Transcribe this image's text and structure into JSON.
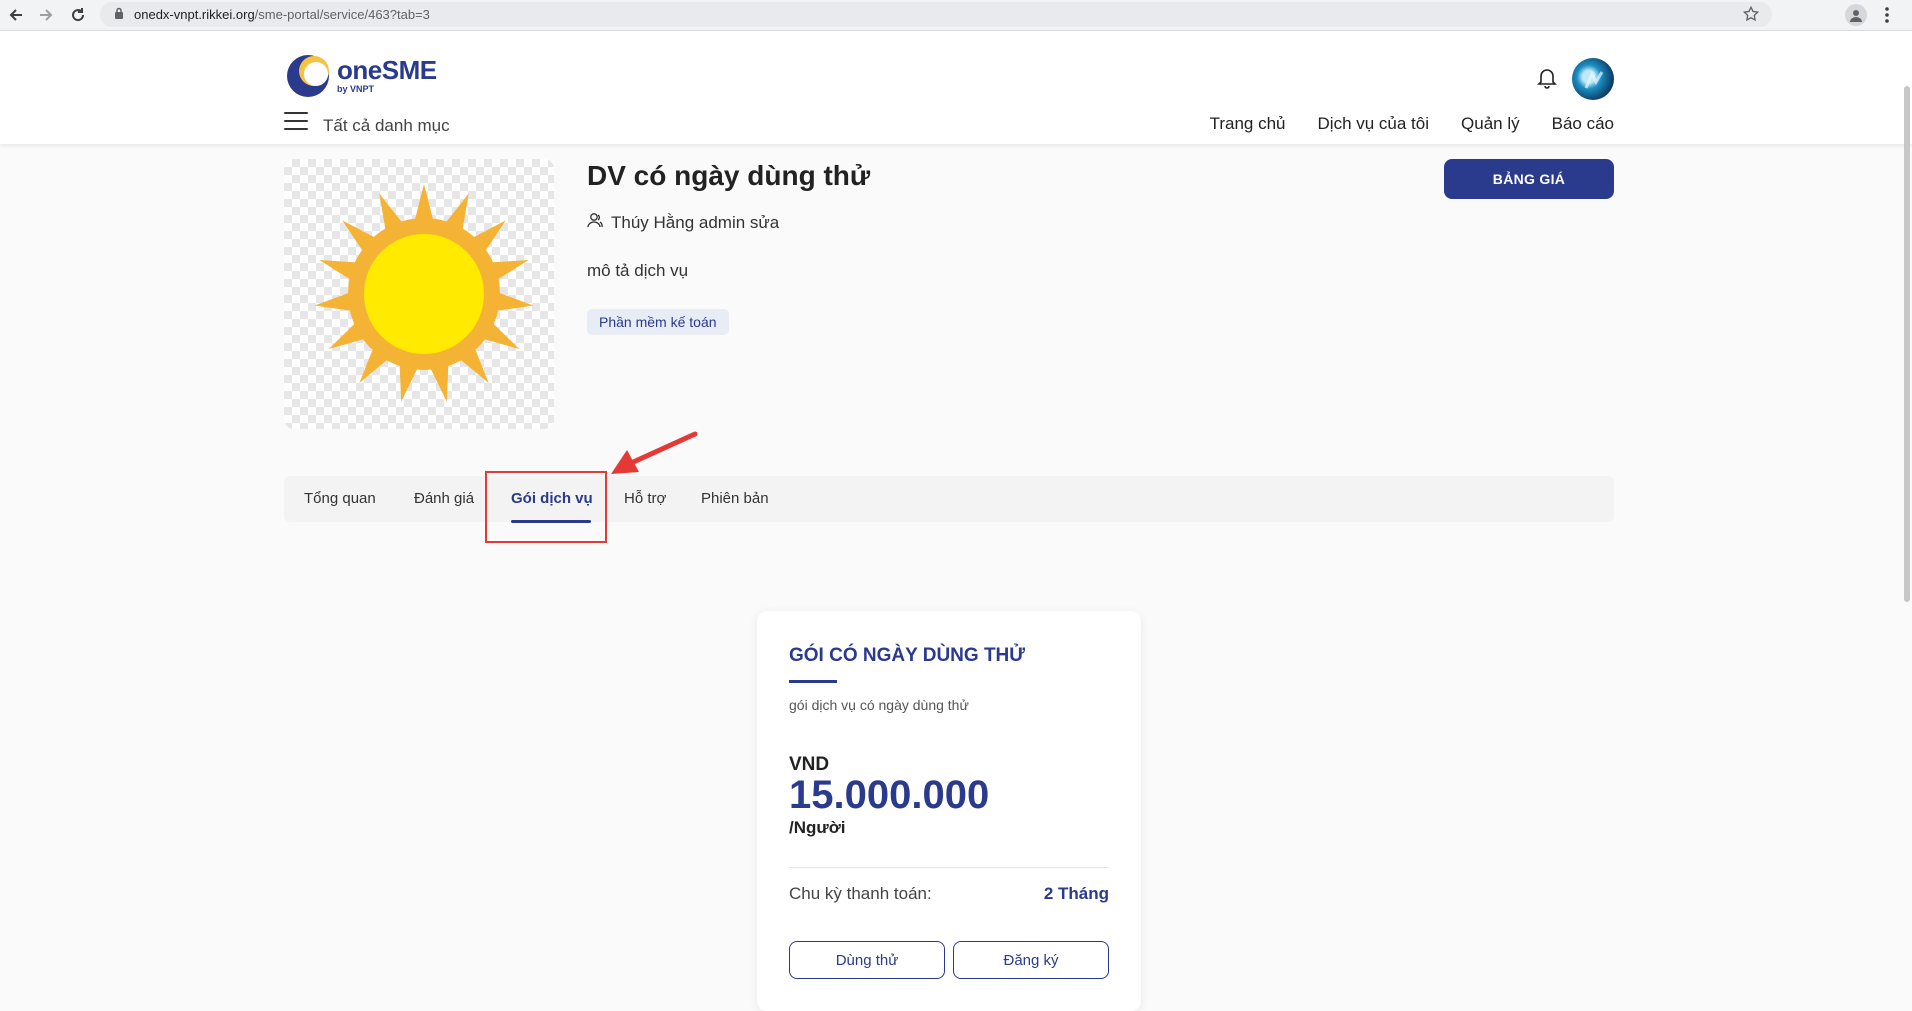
{
  "browser": {
    "url_host": "onedx-vnpt.rikkei.org",
    "url_path": "/sme-portal/service/463?tab=3"
  },
  "header": {
    "logo_text": "oneSME",
    "logo_sub": "by VNPT",
    "all_categories": "Tất cả danh mục",
    "nav": [
      "Trang chủ",
      "Dịch vụ của tôi",
      "Quản lý",
      "Báo cáo"
    ]
  },
  "service": {
    "title": "DV có ngày dùng thử",
    "owner": "Thúy Hằng admin sửa",
    "description": "mô tả dịch vụ",
    "tag": "Phần mềm kế toán",
    "price_button": "BẢNG GIÁ"
  },
  "tabs": [
    "Tổng quan",
    "Đánh giá",
    "Gói dịch vụ",
    "Hỗ trợ",
    "Phiên bản"
  ],
  "active_tab": "Gói dịch vụ",
  "package": {
    "title": "GÓI CÓ NGÀY DÙNG THỬ",
    "description": "gói dịch vụ có ngày dùng thử",
    "currency": "VND",
    "amount": "15.000.000",
    "unit": "/Người",
    "cycle_label": "Chu kỳ thanh toán:",
    "cycle_value": "2 Tháng",
    "trial_button": "Dùng thử",
    "register_button": "Đăng ký"
  },
  "colors": {
    "brand": "#2a3a8c",
    "annotation": "#e53935"
  }
}
